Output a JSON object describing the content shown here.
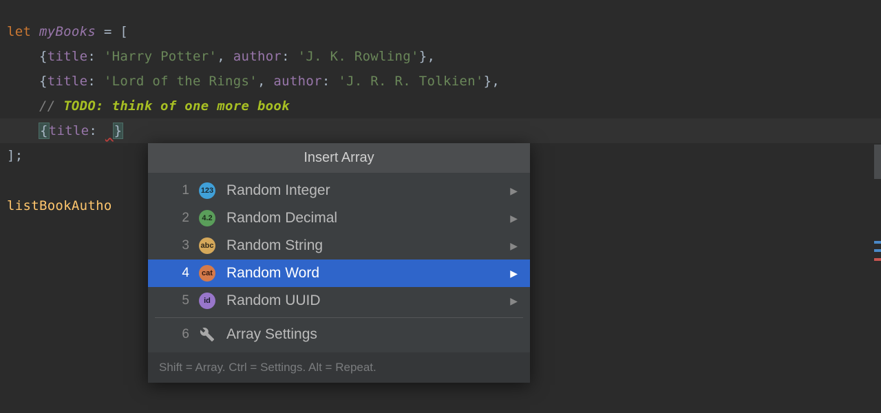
{
  "code": {
    "l1_let": "let",
    "l1_var": "myBooks",
    "l1_rest": " = [",
    "l2_pre": "    {",
    "l2_title_key": "title",
    "l2_sep1": ": ",
    "l2_title_val": "'Harry Potter'",
    "l2_mid": ", ",
    "l2_author_key": "author",
    "l2_sep2": ": ",
    "l2_author_val": "'J. K. Rowling'",
    "l2_end": "},",
    "l3_pre": "    {",
    "l3_title_key": "title",
    "l3_sep1": ": ",
    "l3_title_val": "'Lord of the Rings'",
    "l3_mid": ", ",
    "l3_author_key": "author",
    "l3_sep2": ": ",
    "l3_author_val": "'J. R. R. Tolkien'",
    "l3_end": "},",
    "l4_pre": "    ",
    "l4_slashes": "// ",
    "l4_todo": "TODO: think of one more book",
    "l5_pre": "    ",
    "l5_open": "{",
    "l5_key": "title",
    "l5_sep": ": ",
    "l5_close": "}",
    "l6": "];",
    "l8": "listBookAutho"
  },
  "popup": {
    "title": "Insert Array",
    "items": [
      {
        "num": "1",
        "icon_text": "123",
        "icon_class": "ic-123",
        "label": "Random Integer",
        "arrow": true
      },
      {
        "num": "2",
        "icon_text": "4.2",
        "icon_class": "ic-42",
        "label": "Random Decimal",
        "arrow": true
      },
      {
        "num": "3",
        "icon_text": "abc",
        "icon_class": "ic-abc",
        "label": "Random String",
        "arrow": true
      },
      {
        "num": "4",
        "icon_text": "cat",
        "icon_class": "ic-cat",
        "label": "Random Word",
        "arrow": true,
        "selected": true
      },
      {
        "num": "5",
        "icon_text": "id",
        "icon_class": "ic-id",
        "label": "Random UUID",
        "arrow": true
      }
    ],
    "settings_num": "6",
    "settings_label": "Array Settings",
    "footer": "Shift = Array. Ctrl = Settings. Alt = Repeat."
  }
}
